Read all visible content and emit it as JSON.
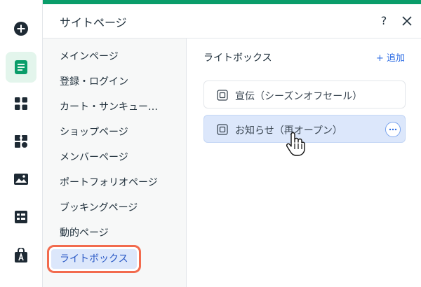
{
  "panel": {
    "title": "サイトページ",
    "help_label": "?"
  },
  "rail": {
    "icons": [
      "add-icon",
      "pages-icon",
      "apps-icon",
      "puzzle-icon",
      "media-icon",
      "cms-icon",
      "app-market-icon"
    ],
    "active": "pages-icon"
  },
  "categories": [
    "メインページ",
    "登録・ログイン",
    "カート・サンキュー…",
    "ショップページ",
    "メンバーページ",
    "ポートフォリオページ",
    "ブッキングページ",
    "動的ページ",
    "ライトボックス"
  ],
  "selected_category": "ライトボックス",
  "section": {
    "title": "ライトボックス",
    "add_label": "+ 追加"
  },
  "pages": [
    {
      "label": "宣伝（シーズンオフセール）"
    },
    {
      "label": "お知らせ（再オープン）"
    }
  ],
  "colors": {
    "accent": "#0a9d6a",
    "link": "#2b6be4",
    "selected_bg": "#dce7fb",
    "highlight": "#f26b4e"
  }
}
